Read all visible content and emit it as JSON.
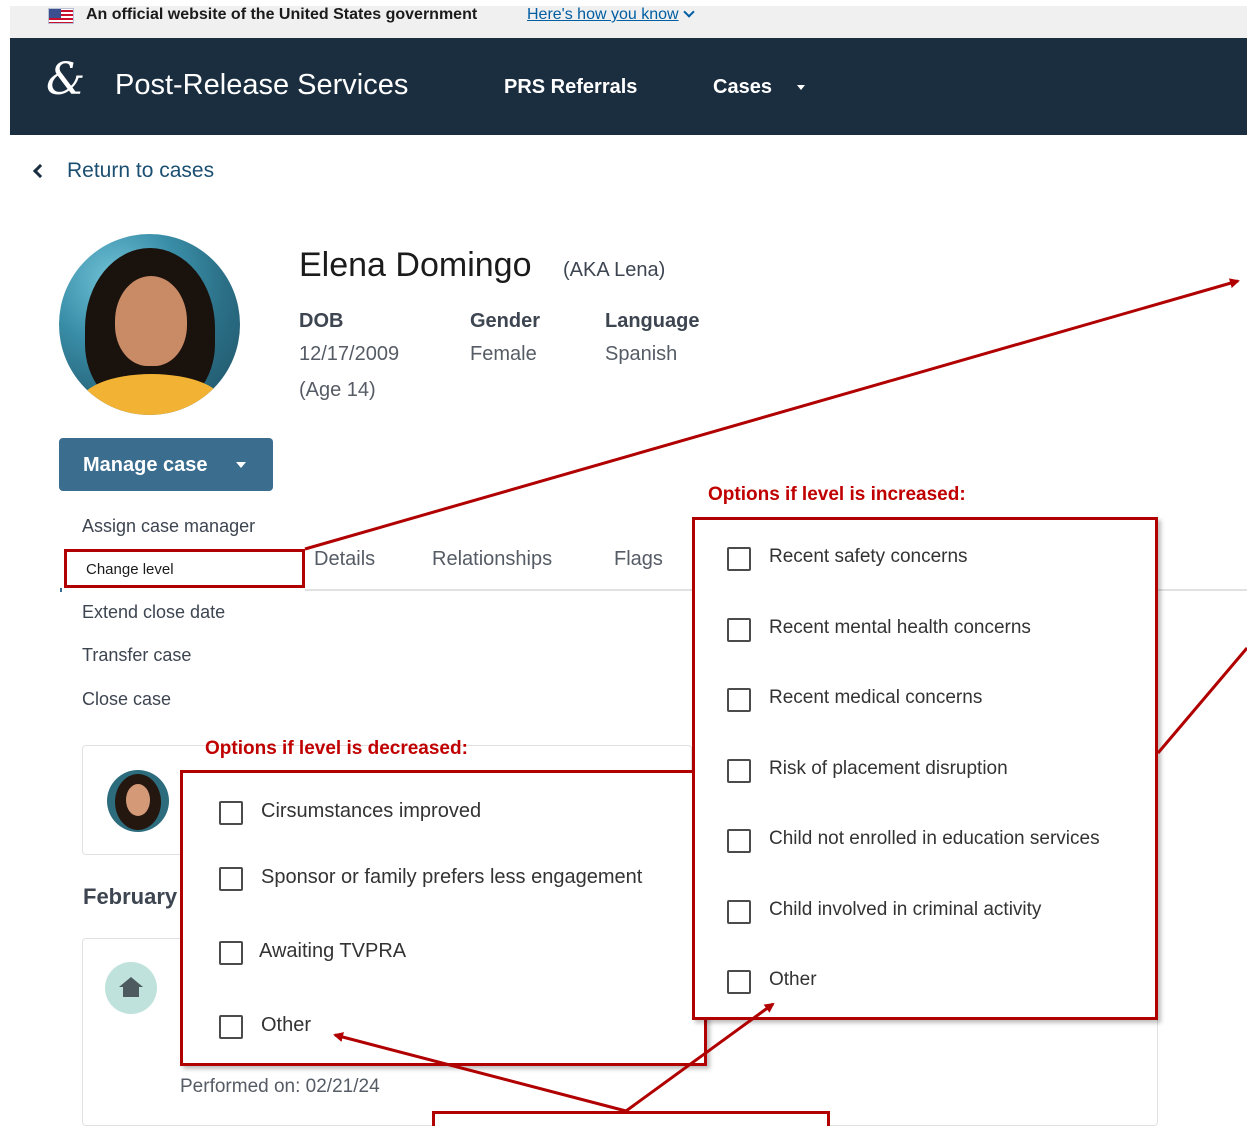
{
  "gov_banner": {
    "text": "An official website of the United States government",
    "link": "Here's how you know",
    "flag_icon": "us-flag-icon"
  },
  "header": {
    "logo_glyph": "&",
    "title": "Post-Release Services",
    "nav": [
      {
        "label": "PRS Referrals"
      },
      {
        "label": "Cases"
      }
    ],
    "bg_color": "#1b2e3f"
  },
  "return_link": "Return to cases",
  "profile": {
    "name": "Elena Domingo",
    "aka": "(AKA Lena)",
    "dob_label": "DOB",
    "dob": "12/17/2009",
    "age": "(Age 14)",
    "gender_label": "Gender",
    "gender": "Female",
    "language_label": "Language",
    "language": "Spanish"
  },
  "manage_case": {
    "label": "Manage case",
    "menu": [
      "Assign case manager",
      "Change level",
      "Extend close date",
      "Transfer case",
      "Close case"
    ]
  },
  "tabs": [
    "Details",
    "Relationships",
    "Flags"
  ],
  "timeline": {
    "month": "February",
    "performed": "Performed on: 02/21/24"
  },
  "annotations": {
    "decreased_heading": "Options if level is decreased:",
    "decreased_options": [
      "Cirsumstances improved",
      "Sponsor or family prefers less engagement",
      "Awaiting TVPRA",
      "Other"
    ],
    "increased_heading": "Options if level is increased:",
    "increased_options": [
      "Recent safety concerns",
      "Recent mental health concerns",
      "Recent medical concerns",
      "Risk of placement disruption",
      "Child not enrolled in education services",
      "Child involved in criminal activity",
      "Other"
    ],
    "accent_color": "#c00000"
  }
}
